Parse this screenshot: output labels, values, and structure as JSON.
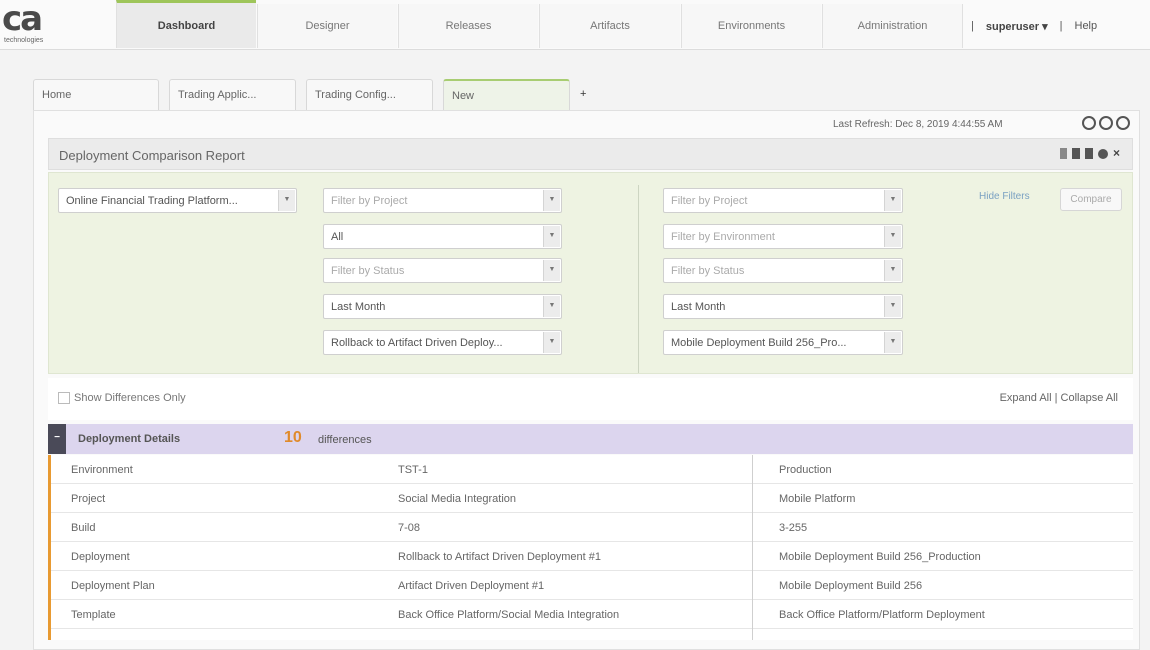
{
  "logo": {
    "brand": "ca",
    "subtitle": "technologies"
  },
  "nav": {
    "tabs": [
      {
        "label": "Dashboard"
      },
      {
        "label": "Designer"
      },
      {
        "label": "Releases"
      },
      {
        "label": "Artifacts"
      },
      {
        "label": "Environments"
      },
      {
        "label": "Administration"
      }
    ],
    "user": "superuser ▾",
    "separator": "|",
    "help": "Help"
  },
  "page_tabs": [
    {
      "label": "Home"
    },
    {
      "label": "Trading Applic..."
    },
    {
      "label": "Trading Config..."
    },
    {
      "label": "New"
    }
  ],
  "add_tab": "+",
  "last_refresh": "Last Refresh: Dec 8, 2019 4:44:55 AM",
  "report": {
    "title": "Deployment Comparison Report",
    "tools": [
      "refresh",
      "print",
      "delete",
      "settings",
      "close"
    ]
  },
  "filters": {
    "application": "Online Financial Trading Platform...",
    "left": [
      {
        "value": "Filter by Project",
        "placeholder": true
      },
      {
        "value": "All",
        "placeholder": false
      },
      {
        "value": "Filter by Status",
        "placeholder": true
      },
      {
        "value": "Last Month",
        "placeholder": false
      },
      {
        "value": "Rollback to Artifact Driven Deploy...",
        "placeholder": false
      }
    ],
    "right": [
      {
        "value": "Filter by Project",
        "placeholder": true
      },
      {
        "value": "Filter by Environment",
        "placeholder": true
      },
      {
        "value": "Filter by Status",
        "placeholder": true
      },
      {
        "value": "Last Month",
        "placeholder": false
      },
      {
        "value": "Mobile Deployment Build 256_Pro...",
        "placeholder": false
      }
    ],
    "hide_filters": "Hide Filters",
    "compare": "Compare"
  },
  "differences": {
    "show_only_label": "Show Differences Only",
    "expand_collapse": "Expand All | Collapse All"
  },
  "group": {
    "toggle": "−",
    "title": "Deployment Details",
    "count": "10",
    "count_label": "differences"
  },
  "rows": [
    {
      "field": "Environment",
      "left": "TST-1",
      "right": "Production"
    },
    {
      "field": "Project",
      "left": "Social Media Integration",
      "right": "Mobile Platform"
    },
    {
      "field": "Build",
      "left": "7-08",
      "right": "3-255"
    },
    {
      "field": "Deployment",
      "left": "Rollback to Artifact Driven Deployment #1",
      "right": "Mobile Deployment Build 256_Production"
    },
    {
      "field": "Deployment Plan",
      "left": "Artifact Driven Deployment #1",
      "right": "Mobile Deployment Build 256"
    },
    {
      "field": "Template",
      "left": "Back Office Platform/Social Media Integration",
      "right": "Back Office Platform/Platform Deployment"
    }
  ]
}
